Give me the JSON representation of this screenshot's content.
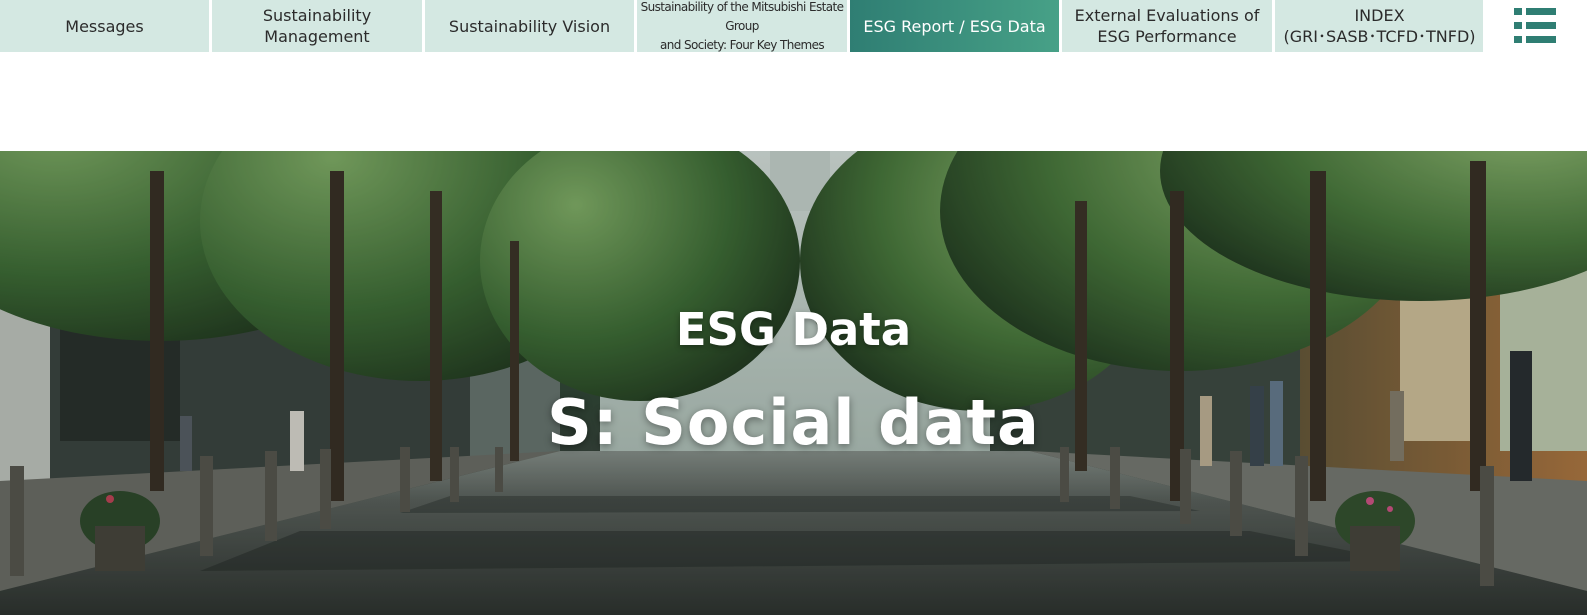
{
  "nav": {
    "tabs": [
      {
        "label": "Messages",
        "active": false
      },
      {
        "label": "Sustainability Management",
        "active": false
      },
      {
        "label": "Sustainability Vision",
        "active": false
      },
      {
        "label": "Sustainability of the Mitsubishi Estate Group\nand Society: Four Key Themes",
        "active": false
      },
      {
        "label": "ESG Report / ESG Data",
        "active": true
      },
      {
        "label": "External Evaluations of\nESG Performance",
        "active": false
      },
      {
        "label": "INDEX\n(GRI･SASB･TCFD･TNFD)",
        "active": false
      }
    ],
    "menu_icon": "hamburger-list-icon",
    "menu_icon_color": "#2f7e73"
  },
  "hero": {
    "kicker": "ESG Data",
    "title": "S: Social data",
    "image": "tree-lined-street-photo"
  },
  "colors": {
    "tab_bg": "#d4e8e2",
    "tab_active_start": "#2f7e73",
    "tab_active_end": "#47a187",
    "tab_text": "#2b2b2b"
  }
}
